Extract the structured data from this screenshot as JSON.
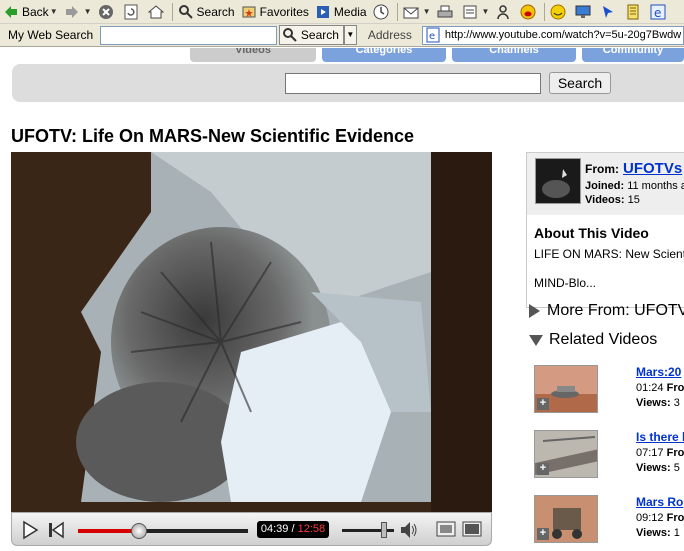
{
  "browser": {
    "back_label": "Back",
    "search_label": "Search",
    "favorites_label": "Favorites",
    "media_label": "Media",
    "my_web_search_label": "My Web Search",
    "search_button_label": "Search",
    "address_label": "Address",
    "address_value": "http://www.youtube.com/watch?v=5u-20g7Bwdw"
  },
  "nav_tabs": [
    {
      "label": "Videos"
    },
    {
      "label": "Categories"
    },
    {
      "label": "Channels"
    },
    {
      "label": "Community"
    }
  ],
  "site_search": {
    "button_label": "Search",
    "value": ""
  },
  "video": {
    "title": "UFOTV: Life On MARS-New Scientific Evidence",
    "current_time": "04:39",
    "separator": "/",
    "total_time": "12:58",
    "progress": 0.36,
    "volume": 0.8
  },
  "uploader": {
    "from_label": "From:",
    "name": "UFOTVs",
    "joined_label": "Joined:",
    "joined_value": "11 months a",
    "videos_label": "Videos:",
    "videos_value": "15"
  },
  "about": {
    "heading": "About This Video",
    "description": "LIFE ON MARS: New Scient",
    "more": "MIND-Blo..."
  },
  "more_from": {
    "heading": "More From: UFOTV"
  },
  "related": {
    "heading": "Related Videos",
    "items": [
      {
        "title": "Mars:20",
        "duration": "01:24",
        "from_label": "Fro",
        "views_label": "Views:",
        "views": "3"
      },
      {
        "title": "Is there l",
        "duration": "07:17",
        "from_label": "Fro",
        "views_label": "Views:",
        "views": "5"
      },
      {
        "title": "Mars Ro",
        "duration": "09:12",
        "from_label": "Fro",
        "views_label": "Views:",
        "views": "1"
      }
    ]
  }
}
